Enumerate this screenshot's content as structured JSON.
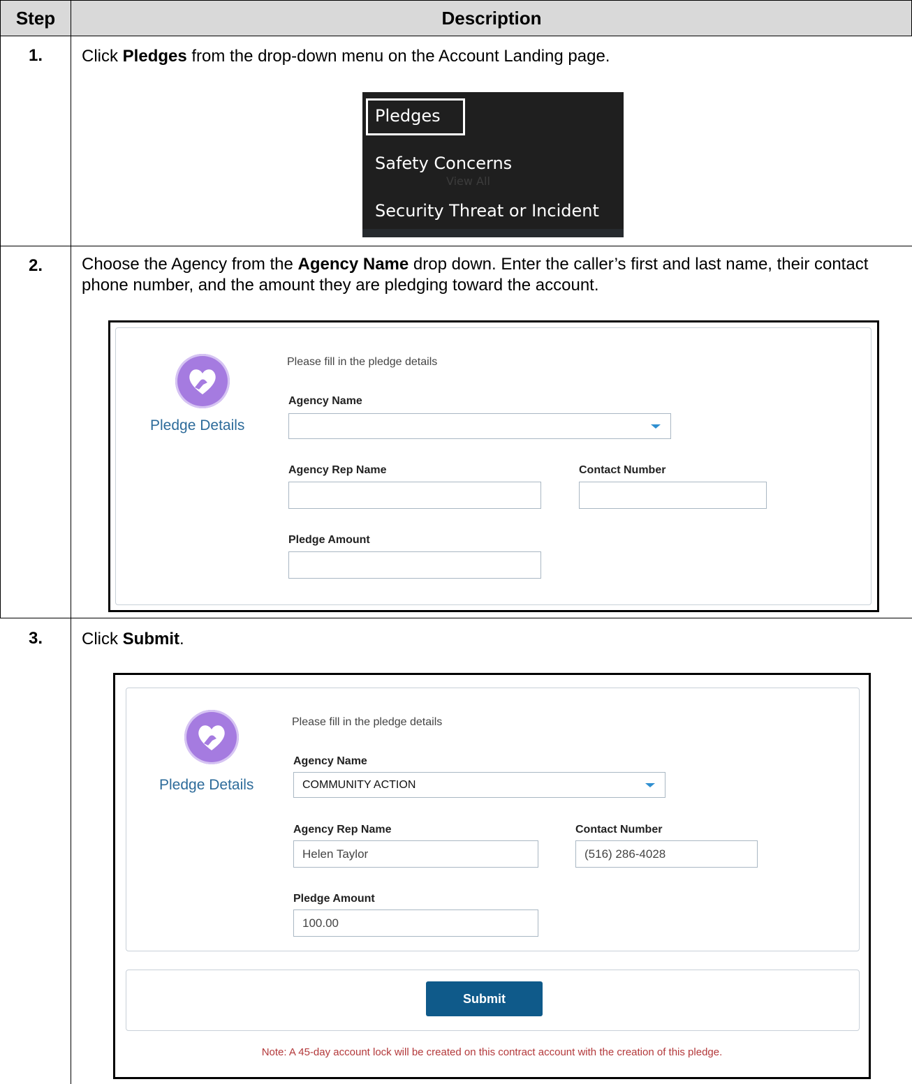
{
  "table": {
    "headers": {
      "step": "Step",
      "description": "Description"
    }
  },
  "step1": {
    "number": "1.",
    "text_before": "Click ",
    "text_bold": "Pledges",
    "text_after": " from the drop-down menu on the Account Landing page.",
    "menu": {
      "items": [
        "Pledges",
        "Safety Concerns",
        "Security Threat or Incident"
      ],
      "ghost_text": "View All",
      "selected": "Pledges"
    }
  },
  "step2": {
    "number": "2.",
    "text_before": "Choose the Agency from the ",
    "text_bold": "Agency Name",
    "text_after": " drop down.  Enter the caller’s first and last name, their contact phone number, and the amount they are pledging toward the account.",
    "form": {
      "section_label": "Pledge Details",
      "intro": "Please fill in the pledge details",
      "agency_name_label": "Agency Name",
      "agency_name_value": "",
      "rep_name_label": "Agency Rep Name",
      "rep_name_value": "",
      "contact_label": "Contact Number",
      "contact_value": "",
      "amount_label": "Pledge Amount",
      "amount_value": ""
    }
  },
  "step3": {
    "number": "3.",
    "text_before": "Click ",
    "text_bold": "Submit",
    "text_after": ".",
    "form": {
      "section_label": "Pledge Details",
      "intro": "Please fill in the pledge details",
      "agency_name_label": "Agency Name",
      "agency_name_value": "COMMUNITY ACTION",
      "rep_name_label": "Agency Rep Name",
      "rep_name_value": "Helen Taylor",
      "contact_label": "Contact Number",
      "contact_value": "(516) 286-4028",
      "amount_label": "Pledge Amount",
      "amount_value": "100.00",
      "submit_label": "Submit",
      "note": "Note: A 45-day account lock will be created on this contract account with the creation of this pledge."
    }
  },
  "colors": {
    "header_bg": "#d9d9d9",
    "menu_bg": "#1f1f1f",
    "accent_blue": "#2d6b9a",
    "submit_bg": "#0f5a8a",
    "icon_purple": "#a57be0",
    "note_red": "#b3383a"
  }
}
